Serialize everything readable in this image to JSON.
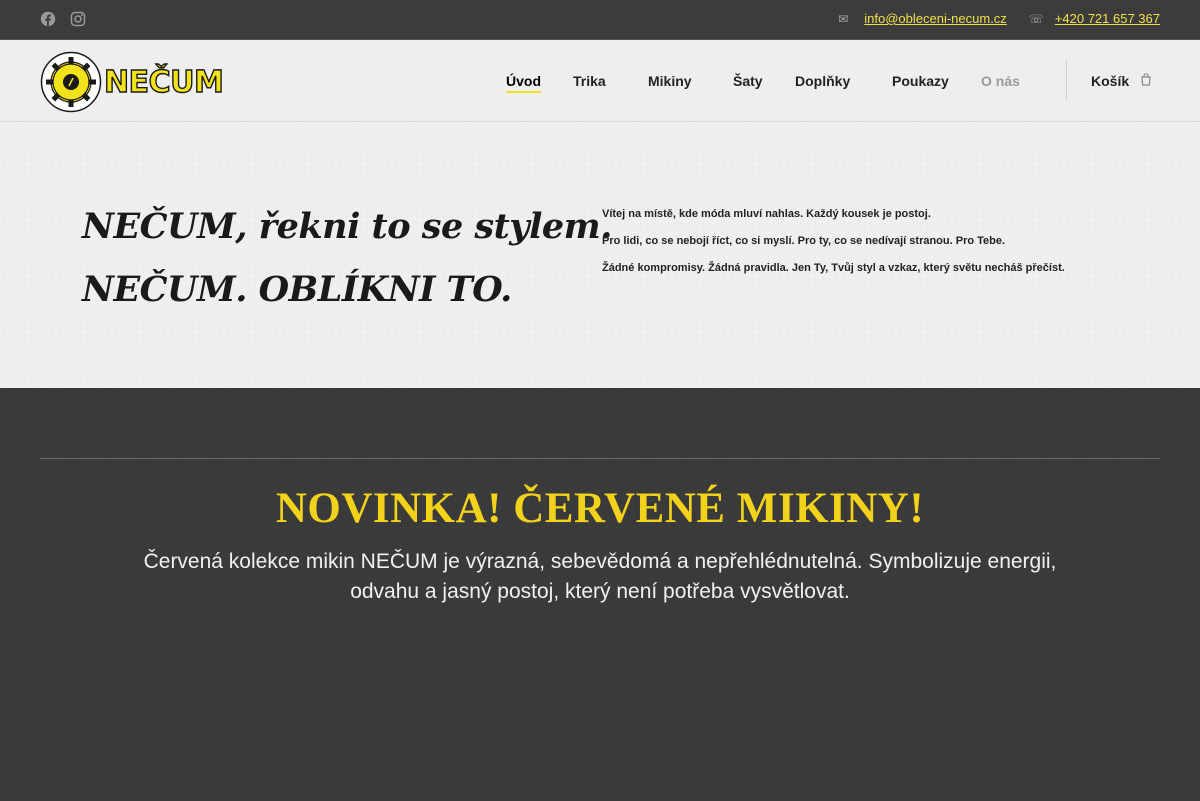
{
  "topbar": {
    "social": [
      {
        "icon": "facebook-icon",
        "label": "Facebook"
      },
      {
        "icon": "instagram-icon",
        "label": "Instagram"
      }
    ],
    "email": {
      "icon": "envelope-icon",
      "text": "info@obleceni-necum.cz"
    },
    "phone": {
      "icon": "phone-icon",
      "text": "+420 721 657 367"
    }
  },
  "header": {
    "logo_text": "NEČUM",
    "nav": [
      {
        "label": "Úvod",
        "active": true
      },
      {
        "label": "Trika"
      },
      {
        "label": "Mikiny"
      },
      {
        "label": "Šaty"
      },
      {
        "label": "Doplňky"
      },
      {
        "label": "Poukazy"
      },
      {
        "label": "O nás"
      }
    ],
    "cart": {
      "label": "Košík",
      "icon": "shopping-bag-icon"
    }
  },
  "hero": {
    "slogan_1": "NEČUM, řekni to se stylem.",
    "slogan_2": "NEČUM. OBLÍKNI TO.",
    "lines": [
      "Vítej na místě, kde móda mluví nahlas. Každý kousek je postoj.",
      "Pro lidi, co se nebojí říct, co si myslí. Pro ty, co se nedívají stranou. Pro Tebe.",
      "Žádné kompromisy. Žádná pravidla. Jen Ty, Tvůj styl a vzkaz, který světu necháš přečíst."
    ]
  },
  "promo": {
    "headline": "NOVINKA! ČERVENÉ MIKINY!",
    "text": "Červená kolekce mikin NEČUM je výrazná, sebevědomá a nepřehlédnutelná. Symbolizuje energii, odvahu a jasný postoj, který není potřeba vysvětlovat."
  },
  "colors": {
    "accent": "#f2e21b",
    "topbar_bg": "#3c3c3c",
    "header_bg": "#eeeeee",
    "dark_bg": "#3a3a3a",
    "headline": "#f2d21b",
    "link": "#f0e04a"
  }
}
